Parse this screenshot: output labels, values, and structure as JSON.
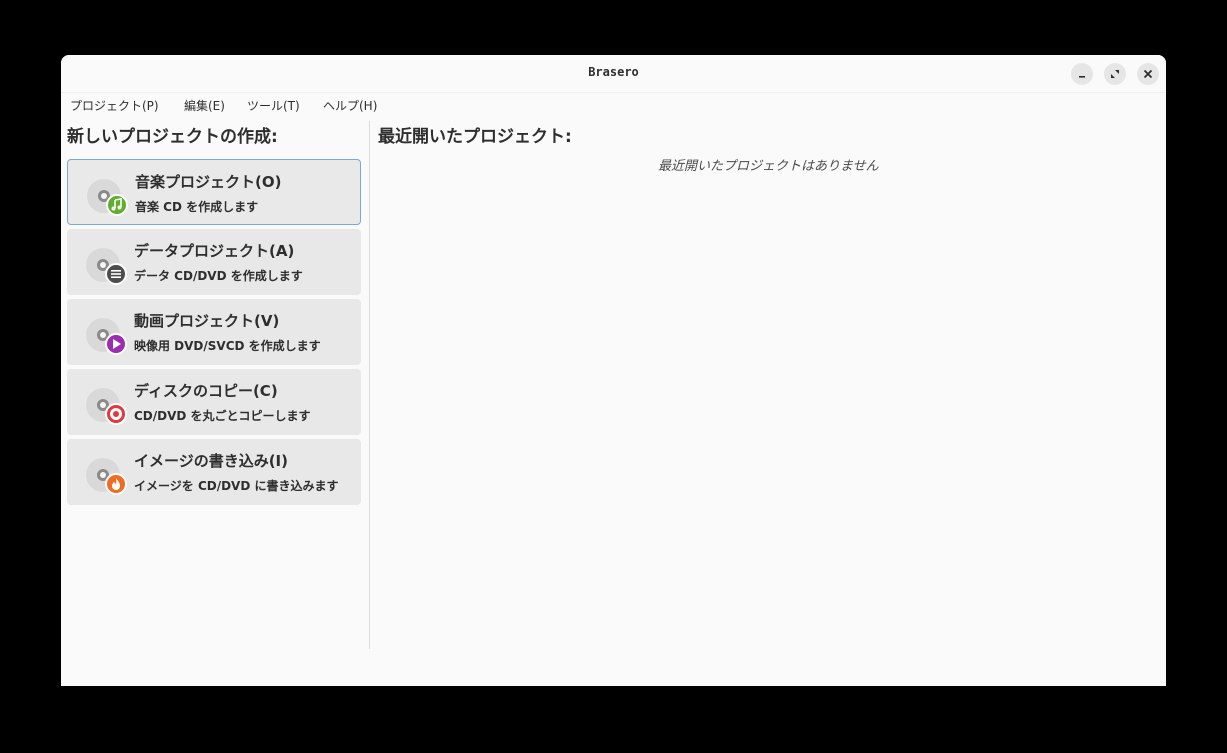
{
  "window": {
    "title": "Brasero"
  },
  "menu": {
    "items": [
      {
        "label": "プロジェクト(P)"
      },
      {
        "label": "編集(E)"
      },
      {
        "label": "ツール(T)"
      },
      {
        "label": "ヘルプ(H)"
      }
    ]
  },
  "new_project": {
    "heading": "新しいプロジェクトの作成:",
    "items": [
      {
        "title": "音楽プロジェクト(O)",
        "subtitle": "音楽 CD を作成します",
        "icon": "music-note-icon",
        "color": "#5fae2f"
      },
      {
        "title": "データプロジェクト(A)",
        "subtitle": "データ CD/DVD を作成します",
        "icon": "data-list-icon",
        "color": "#4d4d4d"
      },
      {
        "title": "動画プロジェクト(V)",
        "subtitle": "映像用 DVD/SVCD を作成します",
        "icon": "play-icon",
        "color": "#9b2eae"
      },
      {
        "title": "ディスクのコピー(C)",
        "subtitle": "CD/DVD を丸ごとコピーします",
        "icon": "disc-copy-icon",
        "color": "#e0393e"
      },
      {
        "title": "イメージの書き込み(I)",
        "subtitle": "イメージを CD/DVD に書き込みます",
        "icon": "flame-icon",
        "color": "#f26b23"
      }
    ]
  },
  "recent": {
    "heading": "最近開いたプロジェクト:",
    "empty_message": "最近開いたプロジェクトはありません"
  }
}
